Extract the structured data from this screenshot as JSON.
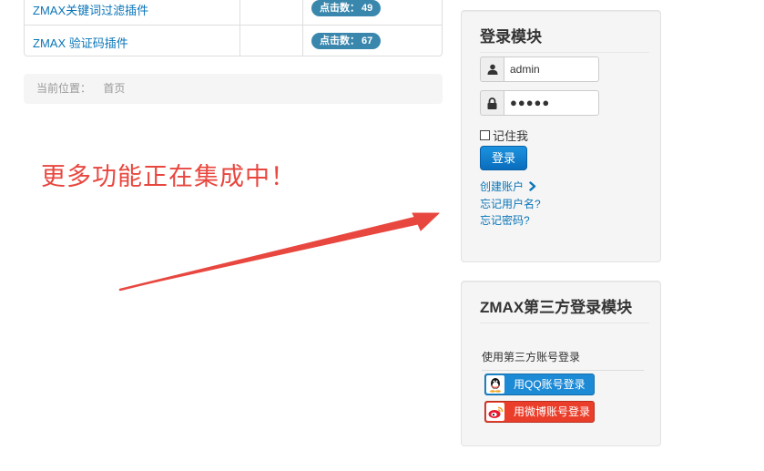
{
  "articles": [
    {
      "title": "ZMAX关键词过滤插件",
      "hits_label": "点击数：",
      "hits": "49"
    },
    {
      "title": "ZMAX 验证码插件",
      "hits_label": "点击数：",
      "hits": "67"
    }
  ],
  "breadcrumb": {
    "label": "当前位置：",
    "home": "首页"
  },
  "annotation": {
    "text": "更多功能正在集成中！",
    "color": "#e8473f"
  },
  "login_module": {
    "title": "登录模块",
    "username_value": "admin",
    "password_mask": "●●●●●",
    "remember_label": "记住我",
    "login_button": "登录",
    "links": {
      "create_account": "创建账户",
      "forgot_username": "忘记用户名?",
      "forgot_password": "忘记密码?"
    },
    "icons": {
      "user": "user-icon",
      "password": "lock-icon",
      "create": "chevron-right-icon"
    }
  },
  "social_module": {
    "title": "ZMAX第三方登录模块",
    "subtitle": "使用第三方账号登录",
    "qq_button": "用QQ账号登录",
    "weibo_button": "用微博账号登录",
    "icons": {
      "qq": "qq-icon",
      "weibo": "weibo-icon"
    }
  },
  "colors": {
    "link": "#0a75b8",
    "badge": "#3a87ad",
    "primary": "#0e7fd0",
    "qq": "#1d8ad6",
    "weibo": "#ea3e2a"
  }
}
